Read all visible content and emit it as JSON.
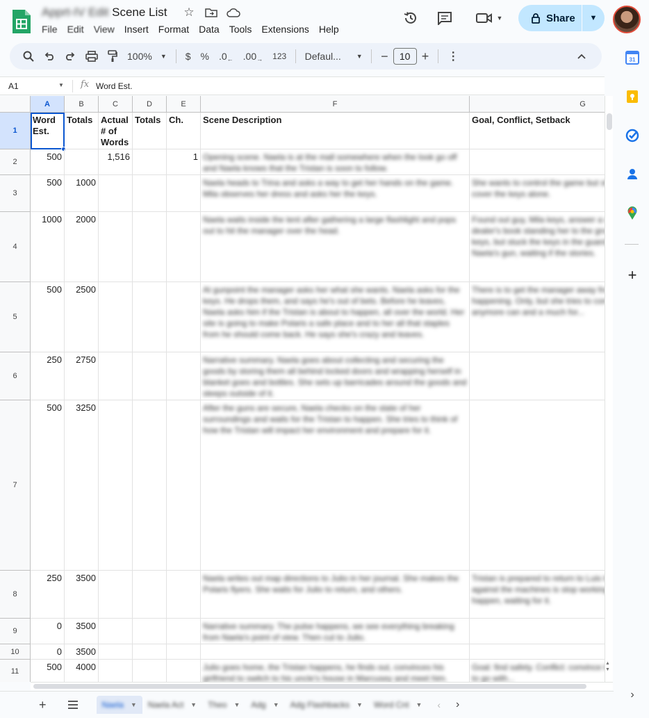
{
  "doc": {
    "title_blurred": "Apprt-IV Edit",
    "title_visible": "Scene List"
  },
  "menu": [
    "File",
    "Edit",
    "View",
    "Insert",
    "Format",
    "Data",
    "Tools",
    "Extensions",
    "Help"
  ],
  "share": {
    "label": "Share"
  },
  "toolbar": {
    "zoom": "100%",
    "currency": "$",
    "percent": "%",
    "dec_dec": ".0",
    "dec_inc": ".00",
    "format_num": "123",
    "font": "Defaul...",
    "font_size": "10",
    "minus": "−",
    "plus": "+"
  },
  "formula_bar": {
    "namebox": "A1",
    "fx": "fx",
    "content": "Word Est."
  },
  "columns": [
    {
      "id": "A",
      "width": 49
    },
    {
      "id": "B",
      "width": 49
    },
    {
      "id": "C",
      "width": 49
    },
    {
      "id": "D",
      "width": 49
    },
    {
      "id": "E",
      "width": 49
    },
    {
      "id": "F",
      "width": 387
    },
    {
      "id": "G",
      "width": 326
    }
  ],
  "header_row": {
    "A": "Word Est.",
    "B": "Totals",
    "C": "Actual # of Words",
    "D": "Totals",
    "E": "Ch.",
    "F": "Scene Description",
    "G": "Goal, Conflict, Setback"
  },
  "rows": [
    {
      "num": "2",
      "A": "500",
      "B": "",
      "C": "1,516",
      "E": "1",
      "F": "Opening scene. Naela is at the mall somewhere when the look go off and Naela knows that the Tristan is soon to follow.",
      "G": ""
    },
    {
      "num": "3",
      "A": "500",
      "B": "1000",
      "F": "Naela heads to Trina and asks a way to get her hands on the game. Mila observes her dress and asks her the keys.",
      "G": "She wants to control the game but she's done, she tries to cover the keys alone."
    },
    {
      "num": "4",
      "A": "1000",
      "B": "2000",
      "F": "Naela waits inside the tent after gathering a large flashlight and pops out to hit the manager over the head.",
      "G": "Found out guy, Mila keys, answer a struggle with the dealer's book standing her to the ground the car, and she keys, but stuck the keys in the guard cabinet, shoplifter the Naela's gun, waiting if the stories."
    },
    {
      "num": "5",
      "A": "500",
      "B": "2500",
      "F": "At gunpoint the manager asks her what she wants. Naela asks for the keys. He drops them, and says he's out of bets. Before he leaves, Naela asks him if the Tristan is about to happen, all over the world. Her site is going to make Polaris a safe place and to her all that staples from he should come back. He says she's crazy and leaves.",
      "G": "There is to get the manager away from her of their tristan is happening. Only, but she tries to convince the crowd anymore can and a much for..."
    },
    {
      "num": "6",
      "A": "250",
      "B": "2750",
      "F": "Narrative summary. Naela goes about collecting and securing the goods by storing them all behind locked doors and wrapping herself in blanket goes and bottles. She sets up barricades around the goods and sleeps outside of it.",
      "G": ""
    },
    {
      "num": "7",
      "A": "500",
      "B": "3250",
      "F": "After the guns are secure, Naela checks on the state of her surroundings and waits for the Tristan to happen. She tries to think of how the Tristan will impact her environment and prepare for it.",
      "G": ""
    },
    {
      "num": "8",
      "A": "250",
      "B": "3500",
      "F": "Naela writes out map directions to Julio in her journal. She makes the Polaris flyers. She waits for Julio to return, and others.",
      "G": "Tristan is prepared to return to Luis title, and she is losing against the machines is stop working, she is prepared to happen, waiting for it."
    },
    {
      "num": "9",
      "A": "0",
      "B": "3500",
      "F": "Narrative summary. The pulse happens, we see everything breaking from Naela's point of view. Then cut to Julio.",
      "G": ""
    },
    {
      "num": "10",
      "A": "0",
      "B": "3500",
      "F": "",
      "G": ""
    },
    {
      "num": "11",
      "A": "500",
      "B": "4000",
      "F": "Julio goes home, the Tristan happens, he finds out, convinces his girlfriend to switch to his uncle's house in Marcusey and meet him.",
      "G": "Goal: find safety. Conflict: convince leaving, setback: he has to go with..."
    }
  ],
  "sheet_tabs": [
    {
      "name": "Naela",
      "active": true
    },
    {
      "name": "Naela Act",
      "active": false
    },
    {
      "name": "Theo",
      "active": false
    },
    {
      "name": "Adg",
      "active": false
    },
    {
      "name": "Adg Flashbacks",
      "active": false
    },
    {
      "name": "Word Cnt",
      "active": false
    }
  ],
  "colors": {
    "accent": "#0b57d0",
    "share_bg": "#c2e7ff",
    "selection": "#d3e3fd"
  }
}
